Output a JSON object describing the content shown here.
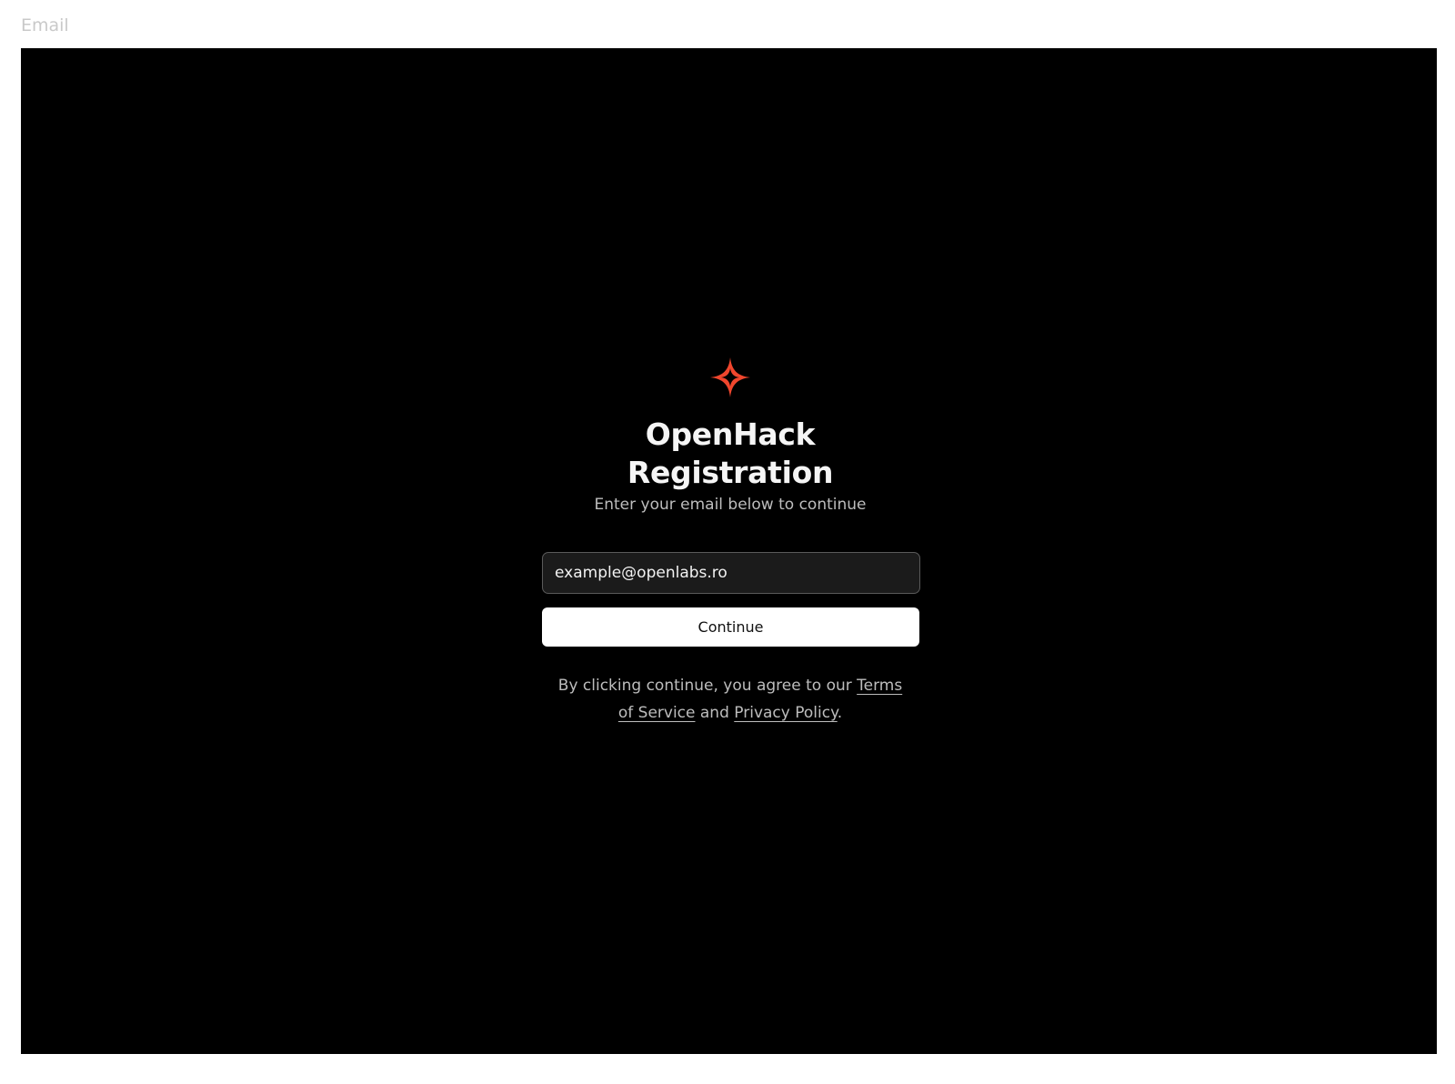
{
  "frame": {
    "label": "Email"
  },
  "brand": {
    "icon": "sparkle-star-icon",
    "accent_color": "#f0462d"
  },
  "form": {
    "title": "OpenHack Registration",
    "subtitle": "Enter your email below to continue",
    "email_value": "example@openlabs.ro",
    "continue_label": "Continue"
  },
  "legal": {
    "prefix": "By clicking continue, you agree to our ",
    "terms_label": "Terms of Service",
    "conjunction": " and ",
    "privacy_label": "Privacy Policy",
    "suffix": "."
  }
}
